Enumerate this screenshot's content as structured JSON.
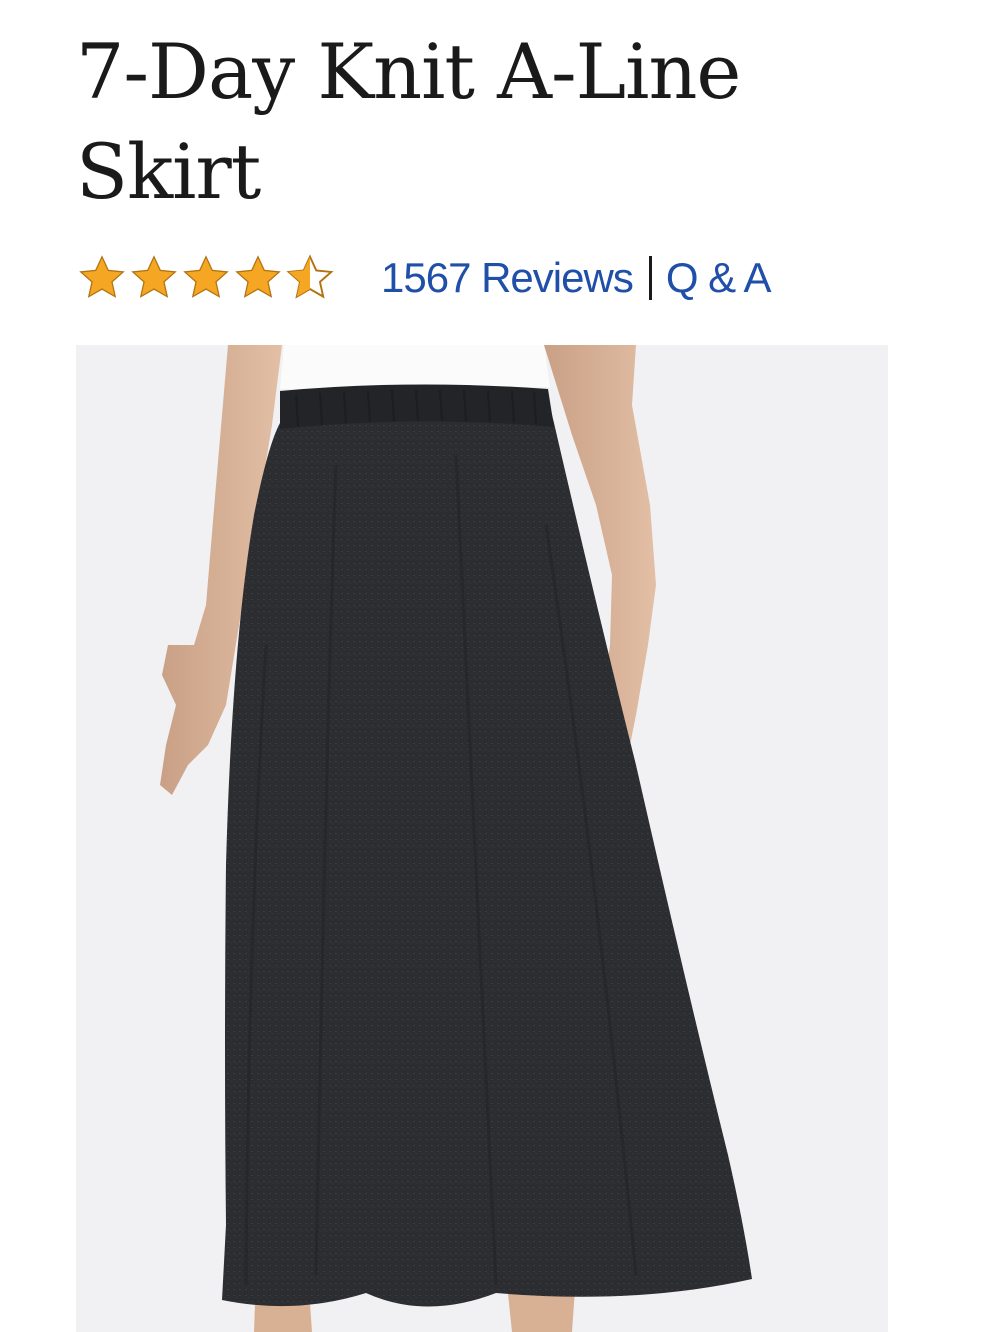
{
  "product": {
    "title": "7-Day Knit A-Line Skirt",
    "rating": 4.5,
    "rating_max": 5,
    "reviews_label": "1567 Reviews",
    "qa_label": "Q & A",
    "image_alt": "Black heather knit A-line skirt"
  },
  "colors": {
    "star": "#f5a623",
    "link": "#1f4fa8",
    "image_bg": "#f1f1f3",
    "skirt": "#2c2d30"
  },
  "icons": {
    "rating_star": "star-icon"
  }
}
